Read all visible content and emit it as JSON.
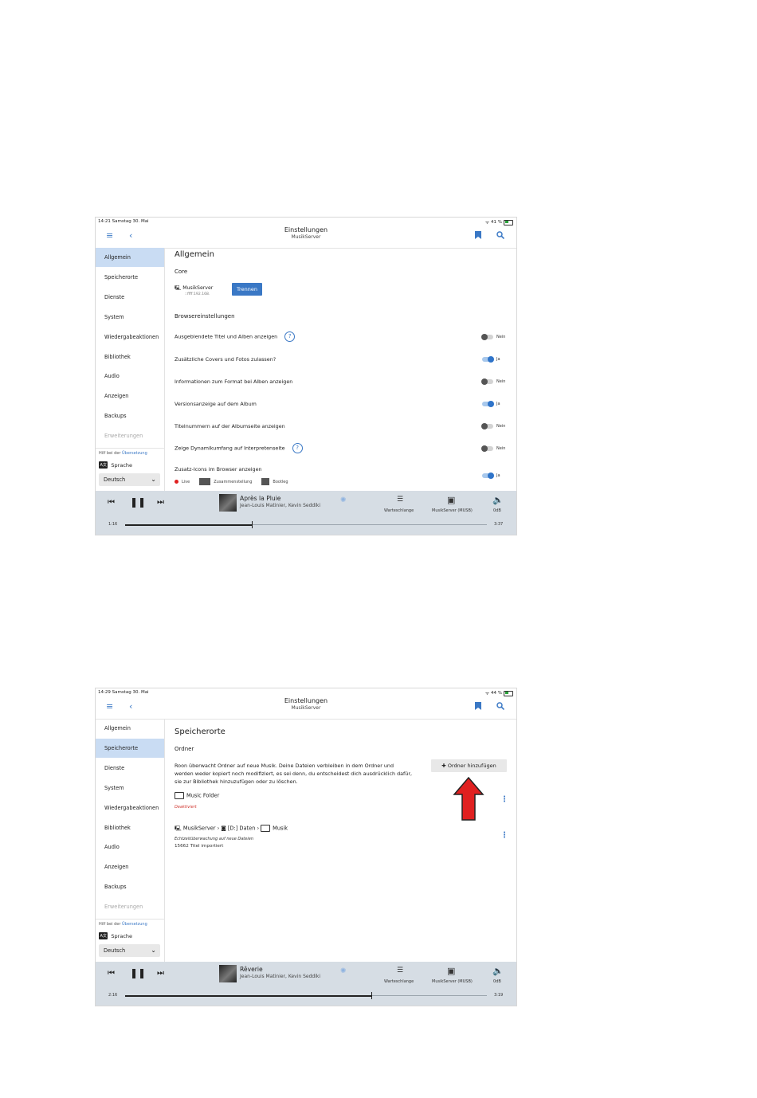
{
  "screens": [
    {
      "status": {
        "time": "14:21  Samstag 30. Mai",
        "battery": "41 %"
      },
      "header": {
        "title": "Einstellungen",
        "subtitle": "MusikServer"
      },
      "sidebar": {
        "items": [
          "Allgemein",
          "Speicherorte",
          "Dienste",
          "System",
          "Wiedergabeaktionen",
          "Bibliothek",
          "Audio",
          "Anzeigen",
          "Backups",
          "Erweiterungen"
        ],
        "help_prefix": "Hilf bei der ",
        "help_link": "Übersetzung",
        "language_label": "Sprache",
        "language_icon": "A文",
        "language_value": "Deutsch"
      },
      "main": {
        "title": "Allgemein",
        "core_heading": "Core",
        "server_name": "MusikServer",
        "server_address": "::ffff:192.168.",
        "disconnect_button": "Trennen",
        "browser_heading": "Browsereinstellungen",
        "settings": [
          {
            "label": "Ausgeblendete Titel und Alben anzeigen",
            "value": "Nein"
          },
          {
            "label": "Zusätzliche Covers und Fotos zulassen?",
            "value": "Ja"
          },
          {
            "label": "Informationen zum Format bei Alben anzeigen",
            "value": "Nein"
          },
          {
            "label": "Versionsanzeige auf dem Album",
            "value": "Ja"
          },
          {
            "label": "Titelnummern auf der Albumseite anzeigen",
            "value": "Nein"
          },
          {
            "label": "Zeige Dynamikumfang auf Interpretenseite",
            "value": "Nein"
          },
          {
            "label": "Zusatz-Icons im Browser anzeigen",
            "value": "Ja"
          }
        ],
        "icon_chips": [
          "Live",
          "Zusammenstellung",
          "Bootleg"
        ]
      },
      "player": {
        "track": "Après la Pluie",
        "artist": "Jean-Louis Matinier, Kevin Seddiki",
        "queue_label": "Warteschlange",
        "zone_label": "MusikServer (MUSB)",
        "volume_label": "0dB",
        "elapsed": "1:16",
        "duration": "3:37",
        "progress": 0.35
      }
    },
    {
      "status": {
        "time": "14:29  Samstag 30. Mai",
        "battery": "44 %"
      },
      "header": {
        "title": "Einstellungen",
        "subtitle": "MusikServer"
      },
      "sidebar": {
        "items": [
          "Allgemein",
          "Speicherorte",
          "Dienste",
          "System",
          "Wiedergabeaktionen",
          "Bibliothek",
          "Audio",
          "Anzeigen",
          "Backups",
          "Erweiterungen"
        ],
        "help_prefix": "Hilf bei der ",
        "help_link": "Übersetzung",
        "language_label": "Sprache",
        "language_icon": "A文",
        "language_value": "Deutsch"
      },
      "main": {
        "title": "Speicherorte",
        "folder_heading": "Ordner",
        "description": "Roon überwacht Ordner auf neue Musik. Deine Dateien verbleiben in dem Ordner und werden weder kopiert noch modifiziert, es sei denn, du entscheidest dich ausdrücklich dafür, sie zur Bibliothek hinzuzufügen oder zu löschen.",
        "add_folder_button": "Ordner hinzufügen",
        "folder1_name": "Music Folder",
        "folder1_status": "Deaktiviert",
        "path_server": "MusikServer",
        "path_drive": "[D:] Daten",
        "path_folder": "Musik",
        "folder2_status": "Echtzeitüberwachung auf neue Dateien",
        "folder2_count": "15662 Titel importiert"
      },
      "player": {
        "track": "Rêverie",
        "artist": "Jean-Louis Matinier, Kevin Seddiki",
        "queue_label": "Warteschlange",
        "zone_label": "MusikServer (MUSB)",
        "volume_label": "0dB",
        "elapsed": "2:16",
        "duration": "3:19",
        "progress": 0.68
      }
    }
  ],
  "colors": {
    "accent": "#3a78c5",
    "active_bg": "#c9dcf3",
    "player_bg": "#d6dde4",
    "arrow": "#e02020"
  }
}
